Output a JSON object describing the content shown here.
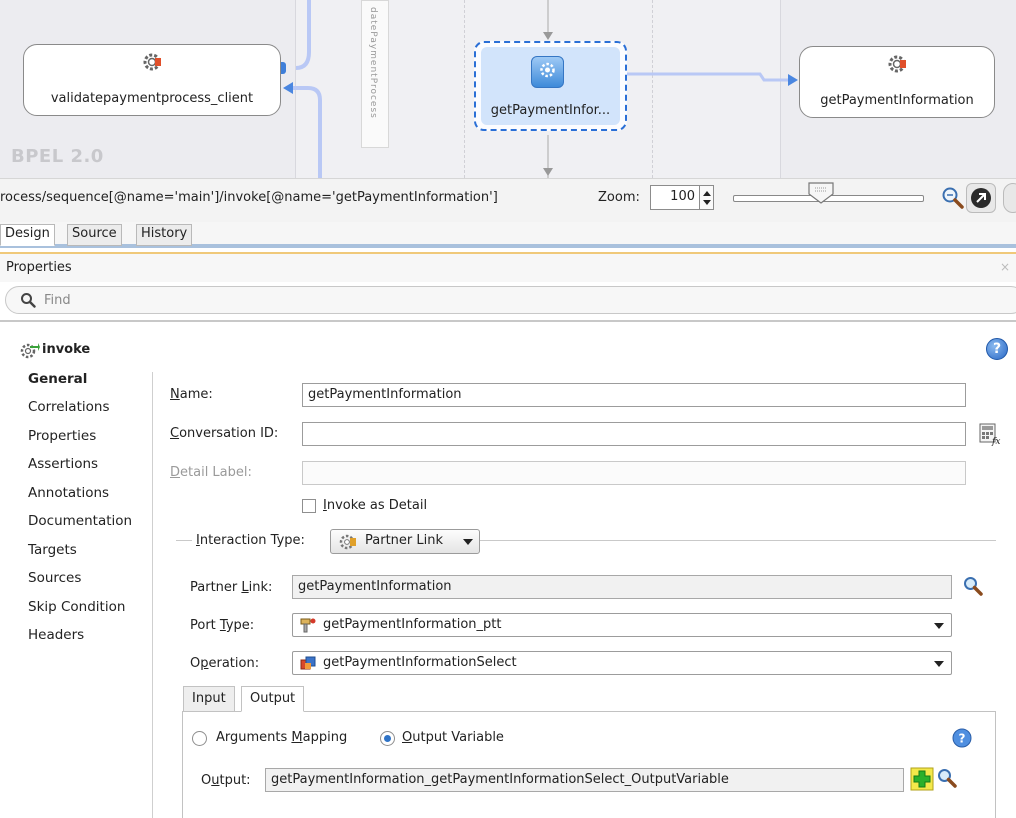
{
  "canvas": {
    "left_partner": "validatepaymentprocess_client",
    "vertical_label": "datePaymentProcess",
    "invoke_node": "getPaymentInfor...",
    "right_partner": "getPaymentInformation",
    "bpel_label": "BPEL 2.0",
    "colors": {
      "selection": "#2a6fd6",
      "wire": "#b9c8f5"
    }
  },
  "pathbar": {
    "path": "rocess/sequence[@name='main']/invoke[@name='getPaymentInformation']",
    "zoom_label": "Zoom:",
    "zoom_value": "100"
  },
  "editor_tabs": [
    "Design",
    "Source",
    "History"
  ],
  "properties": {
    "title": "Properties",
    "close": "×",
    "find_placeholder": "Find",
    "section_title": "invoke",
    "help": "?"
  },
  "nav": [
    "General",
    "Correlations",
    "Properties",
    "Assertions",
    "Annotations",
    "Documentation",
    "Targets",
    "Sources",
    "Skip Condition",
    "Headers"
  ],
  "form": {
    "name_label_mn": "N",
    "name_label_rest": "ame:",
    "name_value": "getPaymentInformation",
    "conv_label_mn": "C",
    "conv_label_rest": "onversation ID:",
    "conv_value": "",
    "detail_label_mn": "D",
    "detail_label_rest": "etail Label:",
    "detail_value": "",
    "invoke_detail_mn": "I",
    "invoke_detail_rest": "nvoke as Detail",
    "interaction_mn": "I",
    "interaction_rest": "nteraction Type:",
    "interaction_value": "Partner Link",
    "partner_link_label_a": "Partner ",
    "partner_link_label_mn": "L",
    "partner_link_label_b": "ink:",
    "partner_link_value": "getPaymentInformation",
    "port_type_label_a": "Port ",
    "port_type_label_mn": "T",
    "port_type_label_b": "ype:",
    "port_type_value": "getPaymentInformation_ptt",
    "operation_label_a": "O",
    "operation_label_mn": "p",
    "operation_label_b": "eration:",
    "operation_value": "getPaymentInformationSelect",
    "tabs": [
      "Input",
      "Output"
    ],
    "args_mapping_a": "Arguments ",
    "args_mapping_mn": "M",
    "args_mapping_b": "apping",
    "output_var_mn": "O",
    "output_var_rest": "utput Variable",
    "output_label_a": "O",
    "output_label_mn": "u",
    "output_label_b": "tput:",
    "output_value": "getPaymentInformation_getPaymentInformationSelect_OutputVariable"
  }
}
